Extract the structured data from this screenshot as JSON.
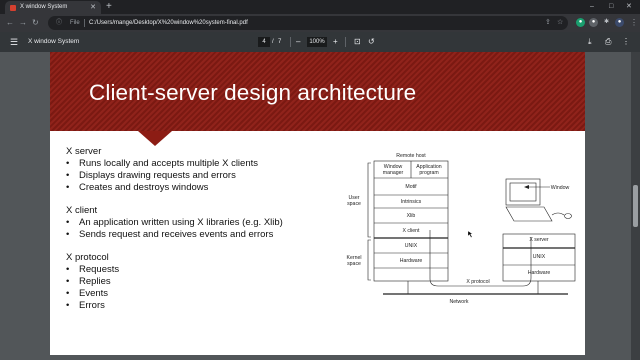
{
  "browser": {
    "tab_title": "X window System",
    "new_tab": "+",
    "window_controls": [
      "–",
      "□",
      "✕"
    ],
    "file_label": "File",
    "url": "C:/Users/mange/Desktop/X%20window%20system-final.pdf"
  },
  "pdf_toolbar": {
    "title": "X window System",
    "current_page": "4",
    "page_separator": "/",
    "total_pages": "7",
    "zoom_minus": "–",
    "zoom": "100%",
    "zoom_plus": "+"
  },
  "slide": {
    "title": "Client-server design architecture",
    "sections": [
      {
        "heading": "X server",
        "items": [
          "Runs locally and accepts multiple X clients",
          "Displays drawing requests and errors",
          "Creates and destroys windows"
        ]
      },
      {
        "heading": "X client",
        "items": [
          "An application written using X libraries (e.g. Xlib)",
          "Sends request and receives events and errors"
        ]
      },
      {
        "heading": "X protocol",
        "items": [
          "Requests",
          "Replies",
          "Events",
          "Errors"
        ]
      }
    ],
    "diagram": {
      "remote_host": "Remote host",
      "window_manager": [
        "Window",
        "manager"
      ],
      "application_program": [
        "Application",
        "program"
      ],
      "motif": "Motif",
      "intrinsics": "Intrinsics",
      "xlib": "Xlib",
      "x_client": "X client",
      "unix_left": "UNIX",
      "hardware_left": "Hardware",
      "user_space": [
        "User",
        "space"
      ],
      "kernel_space": [
        "Kernel",
        "space"
      ],
      "x_protocol": "X protocol",
      "network": "Network",
      "window_label": "Window",
      "x_server": "X server",
      "unix_right": "UNIX",
      "hardware_right": "Hardware"
    }
  }
}
